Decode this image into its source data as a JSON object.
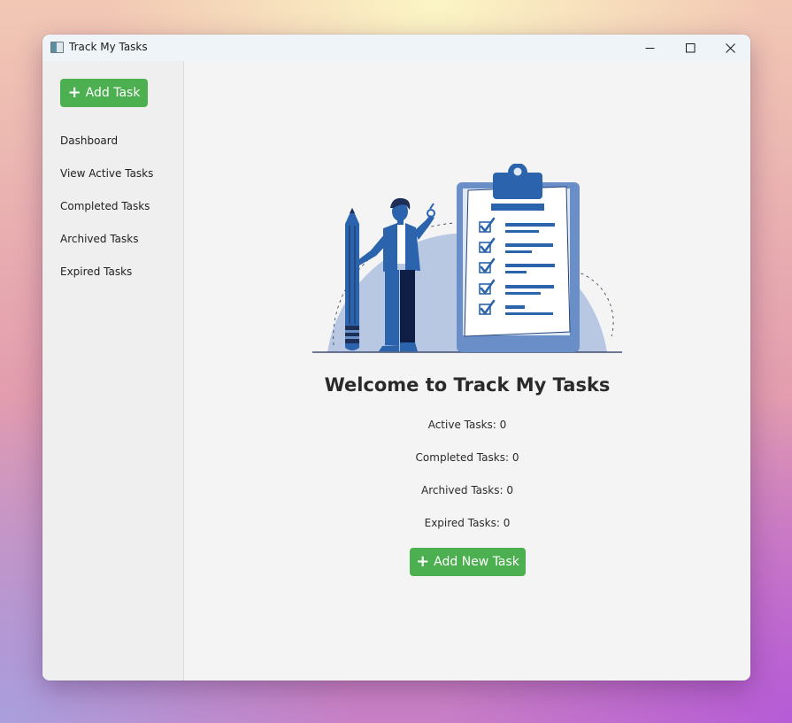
{
  "window": {
    "title": "Track My Tasks",
    "controls": {
      "minimize_icon": "minimize-icon",
      "maximize_icon": "maximize-icon",
      "close_icon": "close-icon"
    }
  },
  "sidebar": {
    "add_button": {
      "label": "Add Task",
      "icon": "plus-icon"
    },
    "items": [
      {
        "label": "Dashboard"
      },
      {
        "label": "View Active Tasks"
      },
      {
        "label": "Completed Tasks"
      },
      {
        "label": "Archived Tasks"
      },
      {
        "label": "Expired Tasks"
      }
    ]
  },
  "main": {
    "illustration": "person-with-pencil-and-checklist-clipboard",
    "welcome": "Welcome to Track My Tasks",
    "stats": [
      {
        "label": "Active Tasks: 0"
      },
      {
        "label": "Completed Tasks: 0"
      },
      {
        "label": "Archived Tasks: 0"
      },
      {
        "label": "Expired Tasks: 0"
      }
    ],
    "add_button": {
      "label": "Add New Task",
      "icon": "plus-icon"
    }
  },
  "colors": {
    "accent_green": "#4caf50",
    "illustration_blue": "#2b64ad",
    "illustration_light": "#b9c8e2"
  }
}
